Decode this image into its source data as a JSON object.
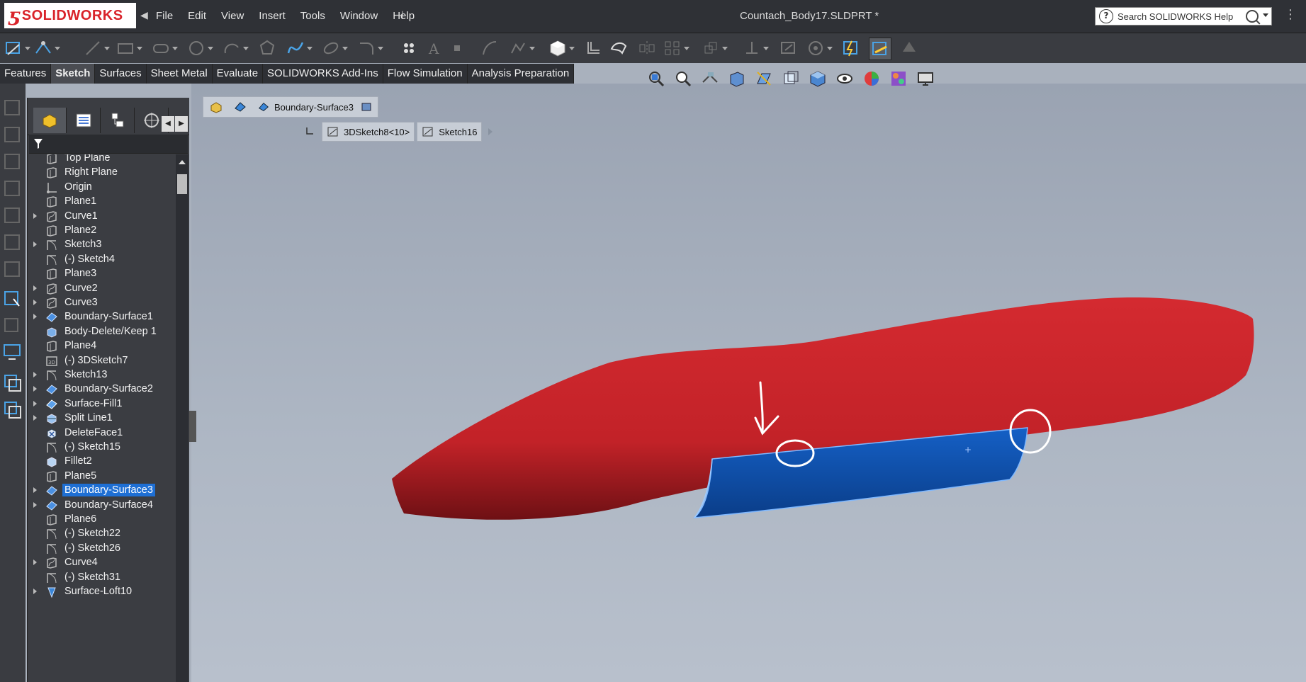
{
  "app": {
    "brand": "SOLIDWORKS",
    "document_title": "Countach_Body17.SLDPRT *",
    "menu": [
      "File",
      "Edit",
      "View",
      "Insert",
      "Tools",
      "Window",
      "Help"
    ],
    "search_placeholder": "Search SOLIDWORKS Help"
  },
  "command_tabs": [
    {
      "label": "Features",
      "active": false
    },
    {
      "label": "Sketch",
      "active": true
    },
    {
      "label": "Surfaces",
      "active": false
    },
    {
      "label": "Sheet Metal",
      "active": false
    },
    {
      "label": "Evaluate",
      "active": false
    },
    {
      "label": "SOLIDWORKS Add-Ins",
      "active": false
    },
    {
      "label": "Flow Simulation",
      "active": false
    },
    {
      "label": "Analysis Preparation",
      "active": false
    }
  ],
  "breadcrumb": {
    "feature": "Boundary-Surface3",
    "children": [
      "3DSketch8<10>",
      "Sketch16"
    ]
  },
  "tree": [
    {
      "label": "Top Plane",
      "icon": "plane-icon",
      "expandable": false
    },
    {
      "label": "Right Plane",
      "icon": "plane-icon",
      "expandable": false
    },
    {
      "label": "Origin",
      "icon": "origin-icon",
      "expandable": false
    },
    {
      "label": "Plane1",
      "icon": "plane-icon",
      "expandable": false
    },
    {
      "label": "Curve1",
      "icon": "curve-icon",
      "expandable": true
    },
    {
      "label": "Plane2",
      "icon": "plane-icon",
      "expandable": false
    },
    {
      "label": "Sketch3",
      "icon": "sketch-icon",
      "expandable": true
    },
    {
      "label": "(-) Sketch4",
      "icon": "sketch-icon",
      "expandable": false
    },
    {
      "label": "Plane3",
      "icon": "plane-icon",
      "expandable": false
    },
    {
      "label": "Curve2",
      "icon": "curve-icon",
      "expandable": true
    },
    {
      "label": "Curve3",
      "icon": "curve-icon",
      "expandable": true
    },
    {
      "label": "Boundary-Surface1",
      "icon": "boundary-surface-icon",
      "expandable": true
    },
    {
      "label": "Body-Delete/Keep 1",
      "icon": "body-delete-icon",
      "expandable": false
    },
    {
      "label": "Plane4",
      "icon": "plane-icon",
      "expandable": false
    },
    {
      "label": "(-) 3DSketch7",
      "icon": "3dsketch-icon",
      "expandable": false
    },
    {
      "label": "Sketch13",
      "icon": "sketch-icon",
      "expandable": true
    },
    {
      "label": "Boundary-Surface2",
      "icon": "boundary-surface-icon",
      "expandable": true
    },
    {
      "label": "Surface-Fill1",
      "icon": "surface-fill-icon",
      "expandable": true
    },
    {
      "label": "Split Line1",
      "icon": "split-line-icon",
      "expandable": true
    },
    {
      "label": "DeleteFace1",
      "icon": "delete-face-icon",
      "expandable": false
    },
    {
      "label": "(-) Sketch15",
      "icon": "sketch-icon",
      "expandable": false
    },
    {
      "label": "Fillet2",
      "icon": "fillet-icon",
      "expandable": false
    },
    {
      "label": "Plane5",
      "icon": "plane-icon",
      "expandable": false
    },
    {
      "label": "Boundary-Surface3",
      "icon": "boundary-surface-icon",
      "expandable": true,
      "selected": true
    },
    {
      "label": "Boundary-Surface4",
      "icon": "boundary-surface-icon",
      "expandable": true
    },
    {
      "label": "Plane6",
      "icon": "plane-icon",
      "expandable": false
    },
    {
      "label": "(-) Sketch22",
      "icon": "sketch-icon",
      "expandable": false
    },
    {
      "label": "(-) Sketch26",
      "icon": "sketch-icon",
      "expandable": false
    },
    {
      "label": "Curve4",
      "icon": "curve-icon",
      "expandable": true
    },
    {
      "label": "(-) Sketch31",
      "icon": "sketch-icon",
      "expandable": false
    },
    {
      "label": "Surface-Loft10",
      "icon": "surface-loft-icon",
      "expandable": true
    }
  ],
  "colors": {
    "body_red": "#d42a30",
    "surface_blue": "#0f4fae",
    "selection": "#1e6fd4",
    "annotation": "#ffffff"
  }
}
